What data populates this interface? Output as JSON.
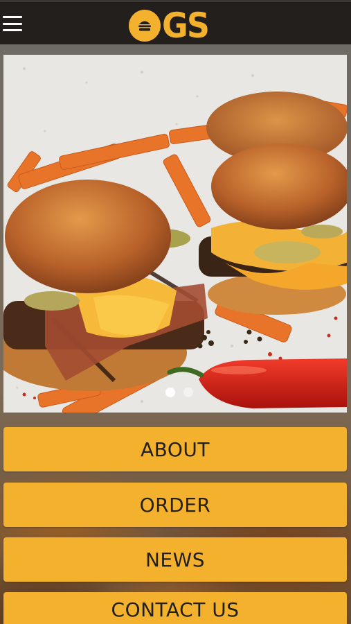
{
  "header": {
    "logo_text": "GS",
    "menu_icon": "hamburger-menu-icon",
    "logo_icon": "burger-icon"
  },
  "hero": {
    "slides_total": 2,
    "active_slide": 1
  },
  "nav": {
    "about": "ABOUT",
    "order": "ORDER",
    "news": "NEWS",
    "contact": "CONTACT US"
  },
  "colors": {
    "brand_yellow": "#f4b12e",
    "header_bg": "#231f1c",
    "button_text": "#231f1c"
  }
}
